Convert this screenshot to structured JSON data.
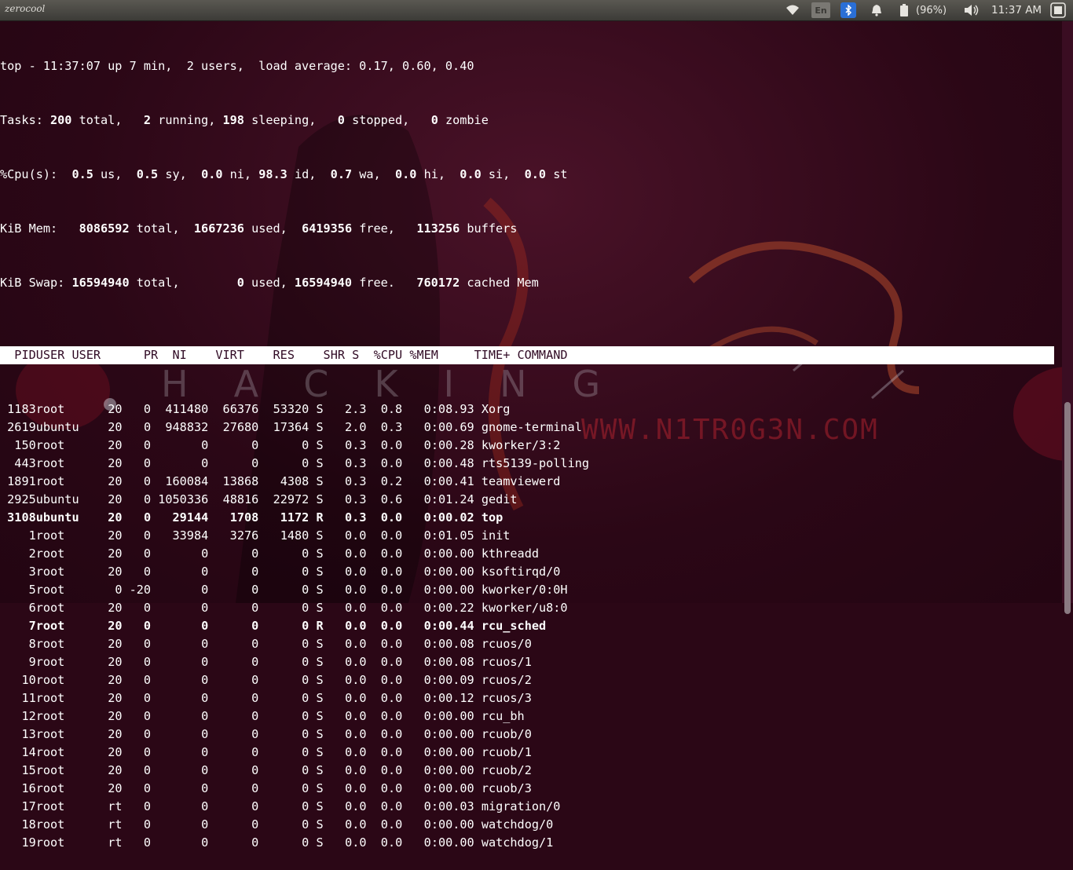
{
  "panel": {
    "title": "zerocool",
    "keyboard_label": "En",
    "battery_label": "(96%)",
    "clock": "11:37 AM",
    "icons": [
      "wifi-icon",
      "bluetooth-icon",
      "bell-icon",
      "battery-icon",
      "volume-icon",
      "power-icon"
    ]
  },
  "wallpaper": {
    "banner": "HACKING",
    "site": "WWW.N1TR0G3N.COM"
  },
  "summary": {
    "line1": "top - 11:37:07 up 7 min,  2 users,  load average: 0.17, 0.60, 0.40",
    "tasks": [
      "Tasks: ",
      "200",
      " total,   ",
      "2",
      " running, ",
      "198",
      " sleeping,   ",
      "0",
      " stopped,   ",
      "0",
      " zombie"
    ],
    "cpu": [
      "%Cpu(s):  ",
      "0.5",
      " us,  ",
      "0.5",
      " sy,  ",
      "0.0",
      " ni, ",
      "98.3",
      " id,  ",
      "0.7",
      " wa,  ",
      "0.0",
      " hi,  ",
      "0.0",
      " si,  ",
      "0.0",
      " st"
    ],
    "mem": [
      "KiB Mem:   ",
      "8086592",
      " total,  ",
      "1667236",
      " used,  ",
      "6419356",
      " free,   ",
      "113256",
      " buffers"
    ],
    "swap": [
      "KiB Swap: ",
      "16594940",
      " total,        ",
      "0",
      " used, ",
      "16594940",
      " free.   ",
      "760172",
      " cached Mem"
    ]
  },
  "columns": [
    "PID",
    "USER",
    "PR",
    "NI",
    "VIRT",
    "RES",
    "SHR",
    "S",
    "%CPU",
    "%MEM",
    "TIME+",
    "COMMAND"
  ],
  "processes": [
    {
      "pid": "1183",
      "user": "root",
      "pr": "20",
      "ni": "0",
      "virt": "411480",
      "res": "66376",
      "shr": "53320",
      "s": "S",
      "cpu": "2.3",
      "mem": "0.8",
      "time": "0:08.93",
      "cmd": "Xorg"
    },
    {
      "pid": "2619",
      "user": "ubuntu",
      "pr": "20",
      "ni": "0",
      "virt": "948832",
      "res": "27680",
      "shr": "17364",
      "s": "S",
      "cpu": "2.0",
      "mem": "0.3",
      "time": "0:00.69",
      "cmd": "gnome-terminal"
    },
    {
      "pid": "150",
      "user": "root",
      "pr": "20",
      "ni": "0",
      "virt": "0",
      "res": "0",
      "shr": "0",
      "s": "S",
      "cpu": "0.3",
      "mem": "0.0",
      "time": "0:00.28",
      "cmd": "kworker/3:2"
    },
    {
      "pid": "443",
      "user": "root",
      "pr": "20",
      "ni": "0",
      "virt": "0",
      "res": "0",
      "shr": "0",
      "s": "S",
      "cpu": "0.3",
      "mem": "0.0",
      "time": "0:00.48",
      "cmd": "rts5139-polling"
    },
    {
      "pid": "1891",
      "user": "root",
      "pr": "20",
      "ni": "0",
      "virt": "160084",
      "res": "13868",
      "shr": "4308",
      "s": "S",
      "cpu": "0.3",
      "mem": "0.2",
      "time": "0:00.41",
      "cmd": "teamviewerd"
    },
    {
      "pid": "2925",
      "user": "ubuntu",
      "pr": "20",
      "ni": "0",
      "virt": "1050336",
      "res": "48816",
      "shr": "22972",
      "s": "S",
      "cpu": "0.3",
      "mem": "0.6",
      "time": "0:01.24",
      "cmd": "gedit"
    },
    {
      "pid": "3108",
      "user": "ubuntu",
      "pr": "20",
      "ni": "0",
      "virt": "29144",
      "res": "1708",
      "shr": "1172",
      "s": "R",
      "cpu": "0.3",
      "mem": "0.0",
      "time": "0:00.02",
      "cmd": "top",
      "bold": true
    },
    {
      "pid": "1",
      "user": "root",
      "pr": "20",
      "ni": "0",
      "virt": "33984",
      "res": "3276",
      "shr": "1480",
      "s": "S",
      "cpu": "0.0",
      "mem": "0.0",
      "time": "0:01.05",
      "cmd": "init"
    },
    {
      "pid": "2",
      "user": "root",
      "pr": "20",
      "ni": "0",
      "virt": "0",
      "res": "0",
      "shr": "0",
      "s": "S",
      "cpu": "0.0",
      "mem": "0.0",
      "time": "0:00.00",
      "cmd": "kthreadd"
    },
    {
      "pid": "3",
      "user": "root",
      "pr": "20",
      "ni": "0",
      "virt": "0",
      "res": "0",
      "shr": "0",
      "s": "S",
      "cpu": "0.0",
      "mem": "0.0",
      "time": "0:00.00",
      "cmd": "ksoftirqd/0"
    },
    {
      "pid": "5",
      "user": "root",
      "pr": "0",
      "ni": "-20",
      "virt": "0",
      "res": "0",
      "shr": "0",
      "s": "S",
      "cpu": "0.0",
      "mem": "0.0",
      "time": "0:00.00",
      "cmd": "kworker/0:0H"
    },
    {
      "pid": "6",
      "user": "root",
      "pr": "20",
      "ni": "0",
      "virt": "0",
      "res": "0",
      "shr": "0",
      "s": "S",
      "cpu": "0.0",
      "mem": "0.0",
      "time": "0:00.22",
      "cmd": "kworker/u8:0"
    },
    {
      "pid": "7",
      "user": "root",
      "pr": "20",
      "ni": "0",
      "virt": "0",
      "res": "0",
      "shr": "0",
      "s": "R",
      "cpu": "0.0",
      "mem": "0.0",
      "time": "0:00.44",
      "cmd": "rcu_sched",
      "bold": true
    },
    {
      "pid": "8",
      "user": "root",
      "pr": "20",
      "ni": "0",
      "virt": "0",
      "res": "0",
      "shr": "0",
      "s": "S",
      "cpu": "0.0",
      "mem": "0.0",
      "time": "0:00.08",
      "cmd": "rcuos/0"
    },
    {
      "pid": "9",
      "user": "root",
      "pr": "20",
      "ni": "0",
      "virt": "0",
      "res": "0",
      "shr": "0",
      "s": "S",
      "cpu": "0.0",
      "mem": "0.0",
      "time": "0:00.08",
      "cmd": "rcuos/1"
    },
    {
      "pid": "10",
      "user": "root",
      "pr": "20",
      "ni": "0",
      "virt": "0",
      "res": "0",
      "shr": "0",
      "s": "S",
      "cpu": "0.0",
      "mem": "0.0",
      "time": "0:00.09",
      "cmd": "rcuos/2"
    },
    {
      "pid": "11",
      "user": "root",
      "pr": "20",
      "ni": "0",
      "virt": "0",
      "res": "0",
      "shr": "0",
      "s": "S",
      "cpu": "0.0",
      "mem": "0.0",
      "time": "0:00.12",
      "cmd": "rcuos/3"
    },
    {
      "pid": "12",
      "user": "root",
      "pr": "20",
      "ni": "0",
      "virt": "0",
      "res": "0",
      "shr": "0",
      "s": "S",
      "cpu": "0.0",
      "mem": "0.0",
      "time": "0:00.00",
      "cmd": "rcu_bh"
    },
    {
      "pid": "13",
      "user": "root",
      "pr": "20",
      "ni": "0",
      "virt": "0",
      "res": "0",
      "shr": "0",
      "s": "S",
      "cpu": "0.0",
      "mem": "0.0",
      "time": "0:00.00",
      "cmd": "rcuob/0"
    },
    {
      "pid": "14",
      "user": "root",
      "pr": "20",
      "ni": "0",
      "virt": "0",
      "res": "0",
      "shr": "0",
      "s": "S",
      "cpu": "0.0",
      "mem": "0.0",
      "time": "0:00.00",
      "cmd": "rcuob/1"
    },
    {
      "pid": "15",
      "user": "root",
      "pr": "20",
      "ni": "0",
      "virt": "0",
      "res": "0",
      "shr": "0",
      "s": "S",
      "cpu": "0.0",
      "mem": "0.0",
      "time": "0:00.00",
      "cmd": "rcuob/2"
    },
    {
      "pid": "16",
      "user": "root",
      "pr": "20",
      "ni": "0",
      "virt": "0",
      "res": "0",
      "shr": "0",
      "s": "S",
      "cpu": "0.0",
      "mem": "0.0",
      "time": "0:00.00",
      "cmd": "rcuob/3"
    },
    {
      "pid": "17",
      "user": "root",
      "pr": "rt",
      "ni": "0",
      "virt": "0",
      "res": "0",
      "shr": "0",
      "s": "S",
      "cpu": "0.0",
      "mem": "0.0",
      "time": "0:00.03",
      "cmd": "migration/0"
    },
    {
      "pid": "18",
      "user": "root",
      "pr": "rt",
      "ni": "0",
      "virt": "0",
      "res": "0",
      "shr": "0",
      "s": "S",
      "cpu": "0.0",
      "mem": "0.0",
      "time": "0:00.00",
      "cmd": "watchdog/0"
    },
    {
      "pid": "19",
      "user": "root",
      "pr": "rt",
      "ni": "0",
      "virt": "0",
      "res": "0",
      "shr": "0",
      "s": "S",
      "cpu": "0.0",
      "mem": "0.0",
      "time": "0:00.00",
      "cmd": "watchdog/1"
    }
  ]
}
